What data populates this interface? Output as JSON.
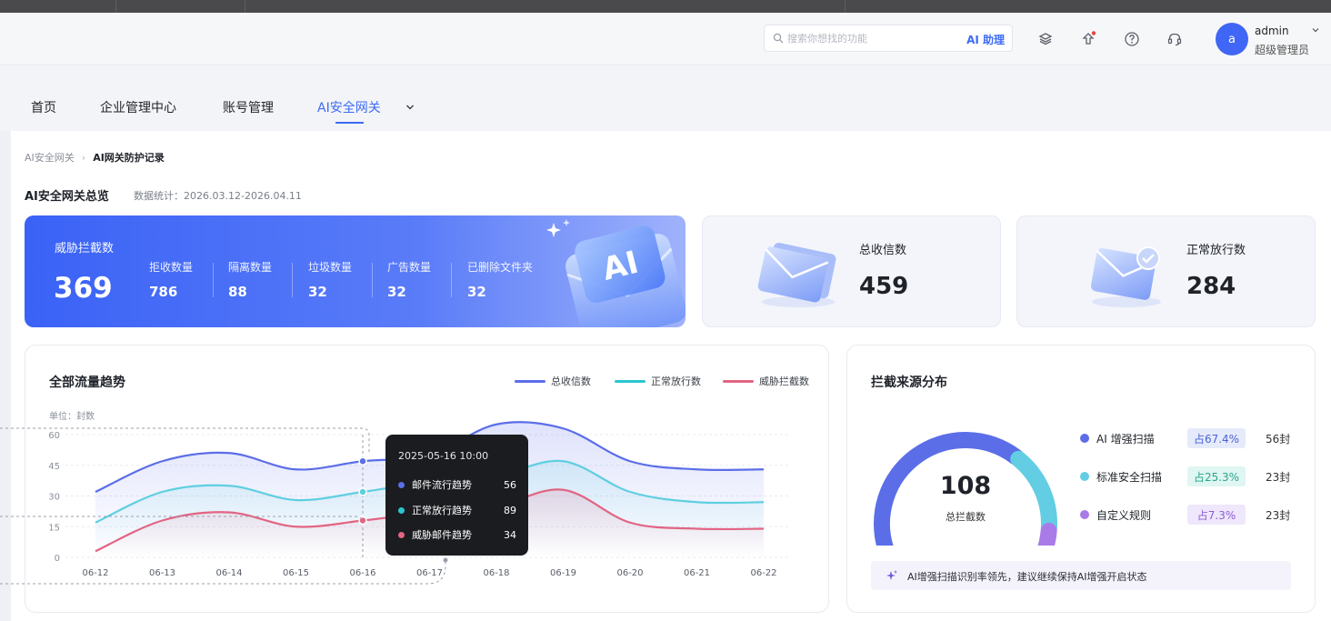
{
  "header": {
    "search_placeholder": "搜索你想找的功能",
    "ai_assistant": "AI 助理",
    "user_initial": "a",
    "user_name": "admin",
    "user_role": "超级管理员"
  },
  "nav": {
    "items": [
      {
        "label": "首页"
      },
      {
        "label": "企业管理中心"
      },
      {
        "label": "账号管理"
      },
      {
        "label": "AI安全网关",
        "active": true
      }
    ]
  },
  "breadcrumb": {
    "parent": "AI安全网关",
    "current": "AI网关防护记录"
  },
  "overview": {
    "title": "AI安全网关总览",
    "range": "数据统计：2026.03.12-2026.04.11"
  },
  "threat_card": {
    "label": "威胁拦截数",
    "value": "369",
    "subs": [
      {
        "label": "拒收数量",
        "value": "786"
      },
      {
        "label": "隔离数量",
        "value": "88"
      },
      {
        "label": "垃圾数量",
        "value": "32"
      },
      {
        "label": "广告数量",
        "value": "32"
      },
      {
        "label": "已删除文件夹",
        "value": "32"
      }
    ]
  },
  "cards": {
    "total_received": {
      "label": "总收信数",
      "value": "459"
    },
    "normal_pass": {
      "label": "正常放行数",
      "value": "284"
    }
  },
  "trend": {
    "title": "全部流量趋势",
    "unit": "单位：封数",
    "legend": [
      {
        "name": "总收信数",
        "color": "#5b6ee8"
      },
      {
        "name": "正常放行数",
        "color": "#2bc6cf"
      },
      {
        "name": "威胁拦截数",
        "color": "#e26583"
      }
    ],
    "tooltip": {
      "date": "2025-05-16 10:00",
      "rows": [
        {
          "name": "邮件流行趋势",
          "value": "56",
          "color": "#5b6ee8"
        },
        {
          "name": "正常放行趋势",
          "value": "89",
          "color": "#2bc6cf"
        },
        {
          "name": "威胁邮件趋势",
          "value": "34",
          "color": "#e26583"
        }
      ]
    }
  },
  "chart_data": {
    "type": "line",
    "x": [
      "06-12",
      "06-13",
      "06-14",
      "06-15",
      "06-16",
      "06-17",
      "06-18",
      "06-19",
      "06-20",
      "06-21",
      "06-22"
    ],
    "yticks": [
      0,
      15,
      30,
      45,
      60
    ],
    "ylim": [
      0,
      60
    ],
    "series": [
      {
        "name": "总收信数",
        "color": "#5b6ee8",
        "values": [
          32,
          47,
          51,
          43,
          47,
          50,
          65,
          63,
          47,
          43,
          43
        ]
      },
      {
        "name": "正常放行数",
        "color": "#5fcfe0",
        "values": [
          17,
          32,
          35,
          28,
          32,
          37,
          40,
          47,
          32,
          27,
          27
        ]
      },
      {
        "name": "威胁拦截数",
        "color": "#e26583",
        "values": [
          3,
          18,
          22,
          15,
          18,
          22,
          25,
          33,
          17,
          14,
          14
        ]
      }
    ]
  },
  "distribution": {
    "title": "拦截来源分布",
    "total": "108",
    "total_label": "总拦截数",
    "items": [
      {
        "name": "AI 增强扫描",
        "pct": "占67.4%",
        "count": "56封",
        "color": "#5b6ee8",
        "bg": "#e6ebfb",
        "fg": "#4a63d8",
        "share": 0.674
      },
      {
        "name": "标准安全扫描",
        "pct": "占25.3%",
        "count": "23封",
        "color": "#63cde3",
        "bg": "#dff6f2",
        "fg": "#2aa58f",
        "share": 0.253
      },
      {
        "name": "自定义规则",
        "pct": "占7.3%",
        "count": "23封",
        "color": "#a97be8",
        "bg": "#efe7fb",
        "fg": "#8c5fd6",
        "share": 0.073
      }
    ],
    "tip": "AI增强扫描识别率领先，建议继续保持AI增强开启状态"
  }
}
